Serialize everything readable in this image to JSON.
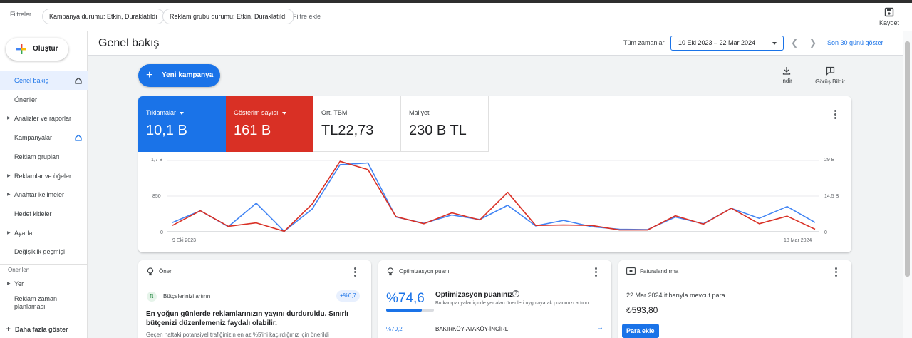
{
  "filterbar": {
    "label": "Filtreler",
    "chips": [
      "Kampanya durumu: Etkin, Duraklatıldı",
      "Reklam grubu durumu: Etkin, Duraklatıldı"
    ],
    "add_filter": "Filtre ekle",
    "save": "Kaydet"
  },
  "sidebar": {
    "create": "Oluştur",
    "items": [
      {
        "label": "Genel bakış",
        "caret": false,
        "active": true,
        "home": true
      },
      {
        "label": "Öneriler",
        "caret": false,
        "active": false,
        "home": false
      },
      {
        "label": "Analizler ve raporlar",
        "caret": true,
        "active": false,
        "home": false
      },
      {
        "label": "Kampanyalar",
        "caret": false,
        "active": false,
        "home": true
      },
      {
        "label": "Reklam grupları",
        "caret": false,
        "active": false,
        "home": false
      },
      {
        "label": "Reklamlar ve öğeler",
        "caret": true,
        "active": false,
        "home": false
      },
      {
        "label": "Anahtar kelimeler",
        "caret": true,
        "active": false,
        "home": false
      },
      {
        "label": "Hedef kitleler",
        "caret": false,
        "active": false,
        "home": false
      },
      {
        "label": "Ayarlar",
        "caret": true,
        "active": false,
        "home": false
      },
      {
        "label": "Değişiklik geçmişi",
        "caret": false,
        "active": false,
        "home": false
      }
    ],
    "section_label": "Önerilen",
    "suggested": [
      {
        "label": "Yer",
        "caret": true
      },
      {
        "label": "Reklam zaman planlaması",
        "caret": false
      }
    ],
    "more": "Daha fazla göster"
  },
  "header": {
    "title": "Genel bakış",
    "range_label": "Tüm zamanlar",
    "range_value": "10 Eki 2023 – 22 Mar 2024",
    "show_last_30": "Son 30 günü göster"
  },
  "actions": {
    "new_campaign": "Yeni kampanya",
    "download": "İndir",
    "feedback": "Görüş Bildir"
  },
  "metrics": [
    {
      "label": "Tıklamalar",
      "value": "10,1 B",
      "bg": "#1a73e8",
      "dropdown": true
    },
    {
      "label": "Gösterim sayısı",
      "value": "161 B",
      "bg": "#d93025",
      "dropdown": true
    },
    {
      "label": "Ort. TBM",
      "value": "TL22,73",
      "bg": "#ffffff",
      "dropdown": false
    },
    {
      "label": "Maliyet",
      "value": "230 B TL",
      "bg": "#ffffff",
      "dropdown": false
    }
  ],
  "chart_data": {
    "type": "line",
    "left_ticks": [
      "1,7 B",
      "850",
      "0"
    ],
    "right_ticks": [
      "29 B",
      "14,5 B",
      "0"
    ],
    "x_start": "9 Eki 2023",
    "x_end": "18 Mar 2024",
    "ylim_left": [
      0,
      1700
    ],
    "ylim_right": [
      0,
      29000
    ],
    "series": [
      {
        "color": "#4285f4",
        "axis": "left",
        "values": [
          220,
          500,
          120,
          680,
          10,
          540,
          1600,
          1640,
          350,
          200,
          400,
          290,
          630,
          140,
          270,
          120,
          60,
          50,
          350,
          190,
          560,
          320,
          600,
          220
        ]
      },
      {
        "color": "#d93025",
        "axis": "left",
        "values": [
          150,
          500,
          130,
          210,
          10,
          660,
          1680,
          1480,
          360,
          190,
          450,
          280,
          940,
          150,
          160,
          150,
          40,
          40,
          380,
          180,
          560,
          190,
          370,
          60
        ]
      }
    ]
  },
  "bottom_cards": {
    "recommendation": {
      "title": "Öneri",
      "item": "Bütçelerinizi artırın",
      "badge": "+%6,7",
      "headline": "En yoğun günlerde reklamlarınızın yayını durduruldu. Sınırlı bütçenizi düzenlemeniz faydalı olabilir.",
      "desc": "Geçen haftaki potansiyel trafiğinizin en az %5'ini kaçırdığınız için önerildi"
    },
    "optimization": {
      "title": "Optimizasyon puanı",
      "score": "%74,6",
      "score_fraction": 0.746,
      "heading": "Optimizasyon puanınız",
      "desc": "Bu kampanyalar içinde yer alan önerileri uygulayarak puanınızı artırın",
      "row_score": "%70,2",
      "row_name": "BAKIRKÖY-ATAKÖY-İNCİRLİ"
    },
    "billing": {
      "title": "Faturalandırma",
      "line": "22 Mar 2024 itibarıyla mevcut para",
      "amount": "₺593,80",
      "button": "Para ekle"
    }
  }
}
